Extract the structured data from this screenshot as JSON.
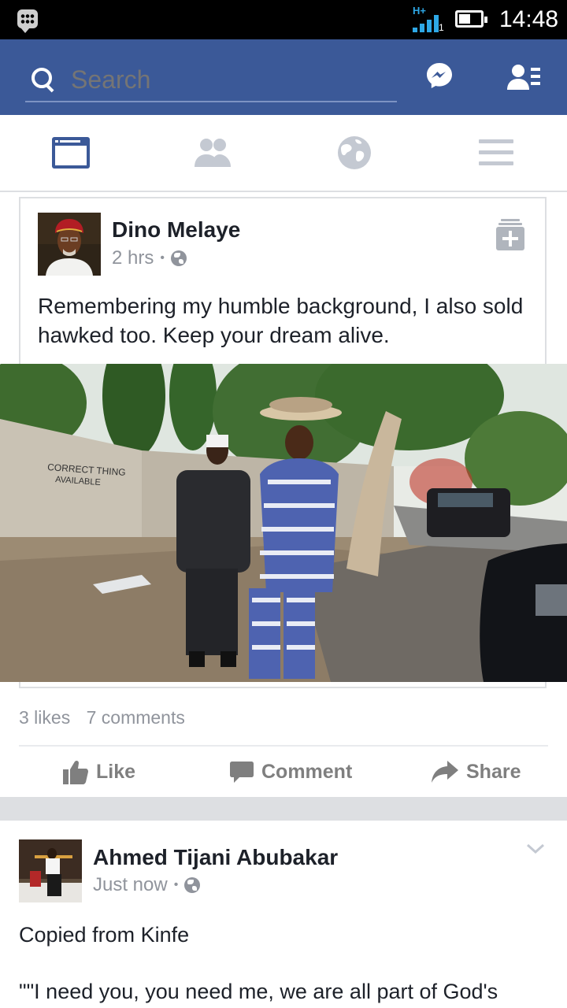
{
  "status_bar": {
    "network": "H+",
    "sim": "1",
    "time": "14:48"
  },
  "header": {
    "search_placeholder": "Search"
  },
  "tabs": [
    "news-feed",
    "friends",
    "notifications",
    "menu"
  ],
  "posts": [
    {
      "author": "Dino Melaye",
      "time": "2 hrs",
      "privacy": "public",
      "text": "Remembering my humble background, I also sold hawked too. Keep your dream alive.",
      "likes": "3 likes",
      "comments": "7 comments"
    },
    {
      "author": "Ahmed Tijani Abubakar",
      "time": "Just now",
      "privacy": "public",
      "text": "Copied from Kinfe",
      "text2": "\"\"I need you, you need me, we are all part of God's"
    }
  ],
  "actions": {
    "like": "Like",
    "comment": "Comment",
    "share": "Share"
  },
  "separator": "•",
  "colors": {
    "brand": "#3b5998",
    "muted": "#90949c"
  }
}
